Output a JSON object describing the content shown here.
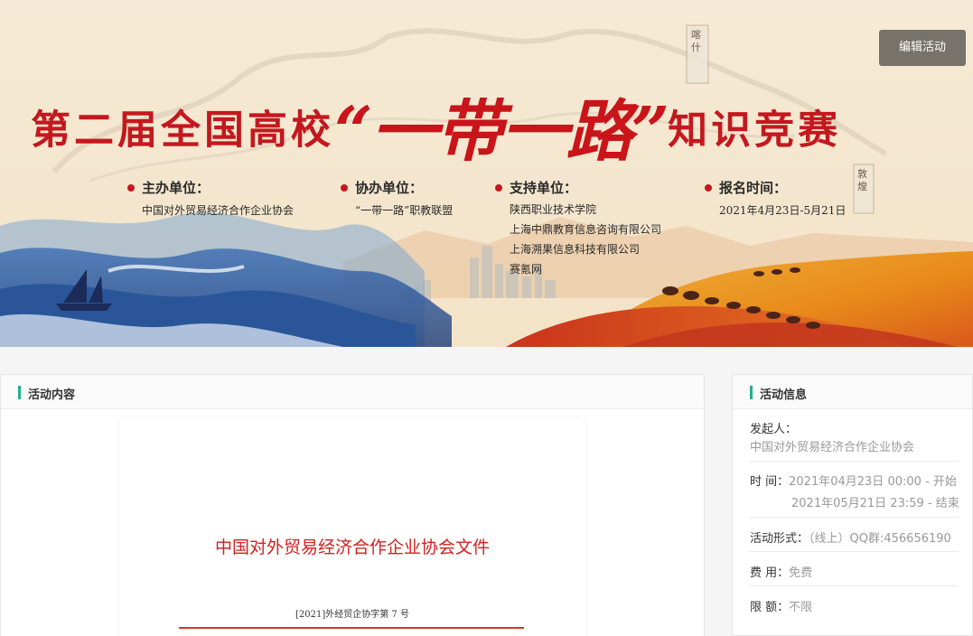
{
  "banner": {
    "edit_button": "编辑活动",
    "title_left": "第二届全国高校",
    "title_mid": "“一带一路”",
    "title_right": "知识竞赛",
    "organizers": [
      {
        "head": "主办单位：",
        "lines": [
          "中国对外贸易经济合作企业协会"
        ]
      },
      {
        "head": "协办单位：",
        "lines": [
          "“一带一路”职教联盟"
        ]
      },
      {
        "head": "支持单位：",
        "lines": [
          "陕西职业技术学院",
          "上海中鼎教育信息咨询有限公司",
          "上海溯果信息科技有限公司",
          "赛氪网"
        ]
      },
      {
        "head": "报名时间：",
        "lines": [
          "2021年4月23日-5月21日"
        ]
      }
    ],
    "map_labels": [
      "喀什",
      "敦煌"
    ]
  },
  "content": {
    "header": "活动内容",
    "doc_title": "中国对外贸易经济合作企业协会文件",
    "doc_number": "[2021]外经贸企协字第 7 号"
  },
  "info": {
    "header": "活动信息",
    "initiator_label": "发起人：",
    "initiator": "中国对外贸易经济合作企业协会",
    "time_label": "时 间：",
    "time_start": "2021年04月23日 00:00 - 开始",
    "time_end": "2021年05月21日 23:59 - 结束",
    "format_label": "活动形式：",
    "format": "（线上）QQ群:456656190",
    "fee_label": "费 用：",
    "fee": "免费",
    "quota_label": "限 额：",
    "quota": "不限"
  },
  "colors": {
    "accent": "#1eb28f",
    "title_red": "#c4181e",
    "edit_bg": "#77726a"
  }
}
